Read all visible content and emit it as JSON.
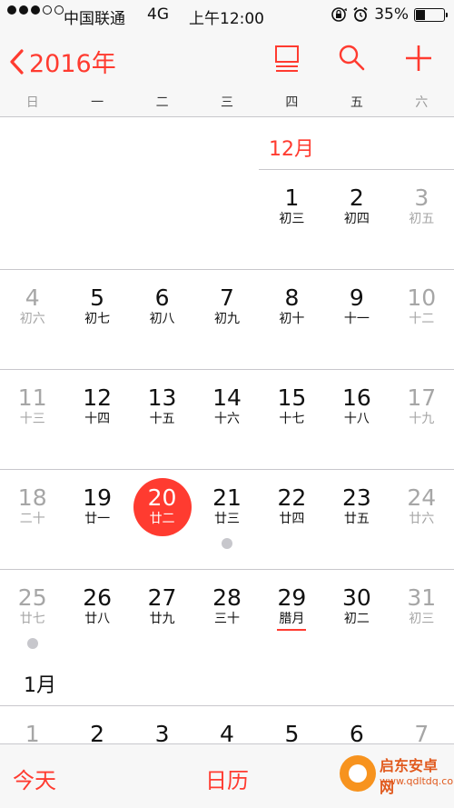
{
  "status_bar": {
    "carrier": "中国联通",
    "network": "4G",
    "time": "上午12:00",
    "battery": "35%",
    "battery_level": 0.35,
    "signal_bars_filled": 3,
    "signal_bars_total": 5
  },
  "nav": {
    "back_label": "2016年",
    "icons": [
      "list-view-icon",
      "search-icon",
      "add-icon"
    ]
  },
  "weekdays": [
    "日",
    "一",
    "二",
    "三",
    "四",
    "五",
    "六"
  ],
  "months": {
    "dec": "12月",
    "jan": "1月"
  },
  "weeks": [
    [
      {
        "d": "",
        "l": ""
      },
      {
        "d": "",
        "l": ""
      },
      {
        "d": "",
        "l": ""
      },
      {
        "d": "",
        "l": ""
      },
      {
        "d": "1",
        "l": "初三"
      },
      {
        "d": "2",
        "l": "初四"
      },
      {
        "d": "3",
        "l": "初五"
      }
    ],
    [
      {
        "d": "4",
        "l": "初六"
      },
      {
        "d": "5",
        "l": "初七"
      },
      {
        "d": "6",
        "l": "初八"
      },
      {
        "d": "7",
        "l": "初九"
      },
      {
        "d": "8",
        "l": "初十"
      },
      {
        "d": "9",
        "l": "十一"
      },
      {
        "d": "10",
        "l": "十二"
      }
    ],
    [
      {
        "d": "11",
        "l": "十三"
      },
      {
        "d": "12",
        "l": "十四"
      },
      {
        "d": "13",
        "l": "十五"
      },
      {
        "d": "14",
        "l": "十六"
      },
      {
        "d": "15",
        "l": "十七"
      },
      {
        "d": "16",
        "l": "十八"
      },
      {
        "d": "17",
        "l": "十九"
      }
    ],
    [
      {
        "d": "18",
        "l": "二十"
      },
      {
        "d": "19",
        "l": "廿一"
      },
      {
        "d": "20",
        "l": "廿二"
      },
      {
        "d": "21",
        "l": "廿三"
      },
      {
        "d": "22",
        "l": "廿四"
      },
      {
        "d": "23",
        "l": "廿五"
      },
      {
        "d": "24",
        "l": "廿六"
      }
    ],
    [
      {
        "d": "25",
        "l": "廿七"
      },
      {
        "d": "26",
        "l": "廿八"
      },
      {
        "d": "27",
        "l": "廿九"
      },
      {
        "d": "28",
        "l": "三十"
      },
      {
        "d": "29",
        "l": "腊月"
      },
      {
        "d": "30",
        "l": "初二"
      },
      {
        "d": "31",
        "l": "初三"
      }
    ],
    [
      {
        "d": "1",
        "l": ""
      },
      {
        "d": "2",
        "l": ""
      },
      {
        "d": "3",
        "l": ""
      },
      {
        "d": "4",
        "l": ""
      },
      {
        "d": "5",
        "l": ""
      },
      {
        "d": "6",
        "l": ""
      },
      {
        "d": "7",
        "l": ""
      }
    ]
  ],
  "today": "20",
  "event_days": [
    "21",
    "25"
  ],
  "lunar_month_start_day": "29",
  "tabbar": {
    "today_label": "今天",
    "calendar_label": "日历"
  },
  "watermark": {
    "title": "启东安卓网",
    "url": "www.qdltdq.com"
  },
  "colors": {
    "accent": "#ff3b30",
    "weekend_text": "#a6a6a6",
    "event_dot": "#c7c7cc"
  }
}
